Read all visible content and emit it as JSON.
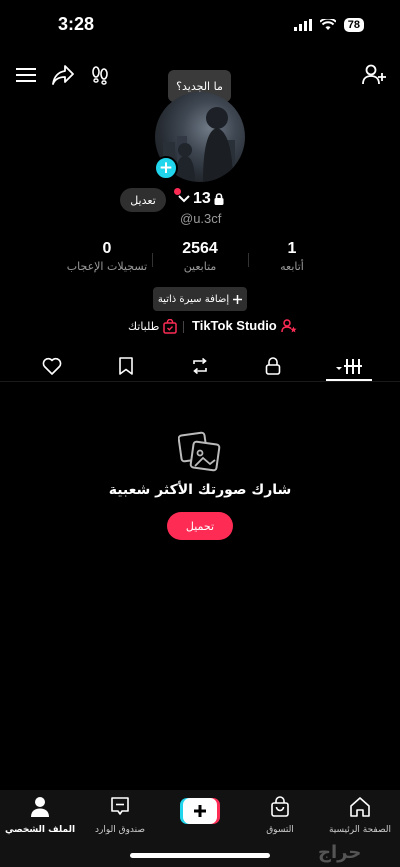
{
  "status_bar": {
    "time": "3:28",
    "battery": "78"
  },
  "tooltip": {
    "text": "ما الجديد؟"
  },
  "profile": {
    "edit_label": "تعديل",
    "username": "13",
    "handle": "@u.3cf"
  },
  "stats": [
    {
      "value": "0",
      "label": "تسجيلات الإعجاب"
    },
    {
      "value": "2564",
      "label": "متابعين"
    },
    {
      "value": "1",
      "label": "أتابعه"
    }
  ],
  "bio_button": {
    "label": "إضافة سيرة ذاتية"
  },
  "links": {
    "studio": "TikTok Studio",
    "orders": "طلباتك"
  },
  "empty_state": {
    "text": "شارك صورتك الأكثر شعبية",
    "upload_label": "تحميل"
  },
  "bottom_nav": [
    {
      "label": "الملف الشخصي",
      "icon": "profile-icon"
    },
    {
      "label": "صندوق الوارد",
      "icon": "inbox-icon"
    },
    {
      "label": "",
      "icon": "plus-icon"
    },
    {
      "label": "التسوق",
      "icon": "shop-icon"
    },
    {
      "label": "الصفحة الرئيسية",
      "icon": "home-icon"
    }
  ],
  "watermark": "حراج",
  "colors": {
    "accent": "#fe2c55",
    "badge": "#20d5ec",
    "background": "#000000"
  }
}
